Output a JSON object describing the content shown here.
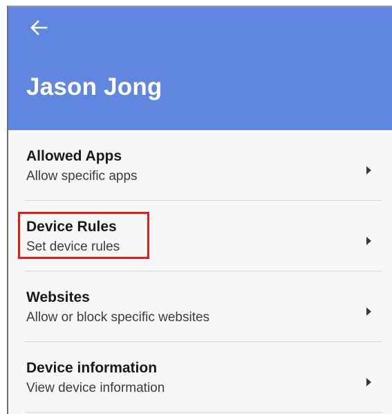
{
  "header": {
    "back_icon": "arrow-left-icon",
    "title": "Jason Jong",
    "background_color": "#5f87e0"
  },
  "menu": {
    "items": [
      {
        "title": "Allowed Apps",
        "subtitle": "Allow specific apps",
        "icon": "chevron-right-icon"
      },
      {
        "title": "Device Rules",
        "subtitle": "Set device rules",
        "icon": "chevron-right-icon",
        "highlighted": true
      },
      {
        "title": "Websites",
        "subtitle": "Allow or block specific websites",
        "icon": "chevron-right-icon"
      },
      {
        "title": "Device information",
        "subtitle": "View device information",
        "icon": "chevron-right-icon"
      }
    ]
  },
  "highlight_color": "#e41b1b"
}
